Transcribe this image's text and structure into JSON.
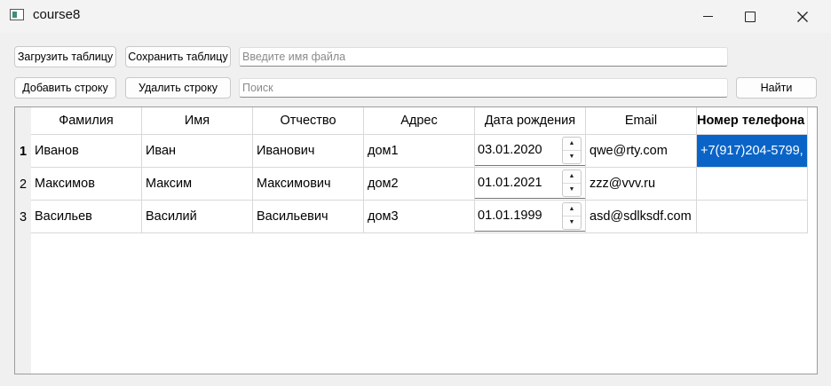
{
  "window": {
    "title": "course8"
  },
  "toolbar": {
    "load_label": "Загрузить таблицу",
    "save_label": "Сохранить таблицу",
    "filename_placeholder": "Введите имя файла",
    "add_label": "Добавить строку",
    "delete_label": "Удалить строку",
    "search_placeholder": "Поиск",
    "find_label": "Найти"
  },
  "table": {
    "columns": [
      "Фамилия",
      "Имя",
      "Отчество",
      "Адрес",
      "Дата рождения",
      "Email",
      "Номер телефона"
    ],
    "rows": [
      {
        "num": "1",
        "surname": "Иванов",
        "name": "Иван",
        "patronymic": "Иванович",
        "address": "дом1",
        "birthdate": "03.01.2020",
        "email": "qwe@rty.com",
        "phone": "+7(917)204-5799,"
      },
      {
        "num": "2",
        "surname": "Максимов",
        "name": "Максим",
        "patronymic": "Максимович",
        "address": "дом2",
        "birthdate": "01.01.2021",
        "email": "zzz@vvv.ru",
        "phone": ""
      },
      {
        "num": "3",
        "surname": "Васильев",
        "name": "Василий",
        "patronymic": "Васильевич",
        "address": "дом3",
        "birthdate": "01.01.1999",
        "email": "asd@sdlksdf.com",
        "phone": ""
      }
    ],
    "selected_row": 1,
    "selected_column": "Номер телефона"
  },
  "icons": {
    "app": "window-app-icon",
    "minimize": "minimize-icon",
    "maximize": "maximize-icon",
    "close": "close-icon",
    "spin_up": "spin-up-arrow-icon",
    "spin_down": "spin-down-arrow-icon"
  },
  "colors": {
    "selection": "#0a64c8",
    "background": "#f0f0f0"
  }
}
